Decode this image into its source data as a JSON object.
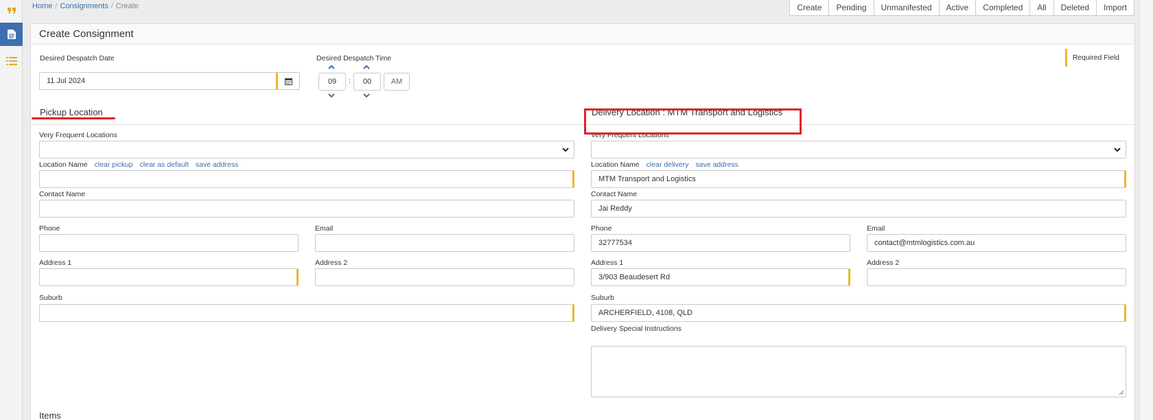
{
  "breadcrumb": {
    "home": "Home",
    "consignments": "Consignments",
    "current": "Create",
    "sep": "/"
  },
  "top_tabs": [
    "Create",
    "Pending",
    "Unmanifested",
    "Active",
    "Completed",
    "All",
    "Deleted",
    "Import"
  ],
  "panel_title": "Create Consignment",
  "despatch": {
    "date_label": "Desired Despatch Date",
    "date_value": "11 Jul 2024",
    "time_label": "Desired Despatch Time",
    "hour": "09",
    "minute": "00",
    "separator": ":",
    "ampm": "AM"
  },
  "required_legend": "Required Field",
  "pickup": {
    "title": "Pickup Location",
    "frequent_label": "Very Frequent Locations",
    "frequent_value": "",
    "location_name_label": "Location Name",
    "link_clear": "clear pickup",
    "link_default": "clear as default",
    "link_save": "save address",
    "location_name_value": "",
    "contact_label": "Contact Name",
    "contact_value": "",
    "phone_label": "Phone",
    "phone_value": "",
    "email_label": "Email",
    "email_value": "",
    "address1_label": "Address 1",
    "address1_value": "",
    "address2_label": "Address 2",
    "address2_value": "",
    "suburb_label": "Suburb",
    "suburb_value": ""
  },
  "delivery": {
    "title": "Delivery Location  : MTM Transport and Logistics",
    "frequent_label": "Very Frequent Locations",
    "frequent_value": "",
    "location_name_label": "Location Name",
    "link_clear": "clear delivery",
    "link_save": "save address",
    "location_name_value": "MTM Transport and Logistics",
    "contact_label": "Contact Name",
    "contact_value": "Jai Reddy",
    "phone_label": "Phone",
    "phone_value": "32777534",
    "email_label": "Email",
    "email_value": "contact@mtmlogistics.com.au",
    "address1_label": "Address 1",
    "address1_value": "3/903 Beaudesert Rd",
    "address2_label": "Address 2",
    "address2_value": "",
    "suburb_label": "Suburb",
    "suburb_value": "ARCHERFIELD, 4108, QLD",
    "instructions_label": "Delivery Special Instructions",
    "instructions_value": ""
  },
  "items_title": "Items",
  "colors": {
    "accent": "#3e6fb0",
    "required": "#f0b429",
    "highlight": "#e2202a",
    "link": "#3b6ea5"
  },
  "icons": {
    "rail": [
      "quote-icon",
      "document-icon",
      "list-icon"
    ],
    "date": "calendar-icon",
    "select": "chevron-down-icon",
    "time_up": "chevron-up-icon",
    "time_down": "chevron-down-icon"
  }
}
